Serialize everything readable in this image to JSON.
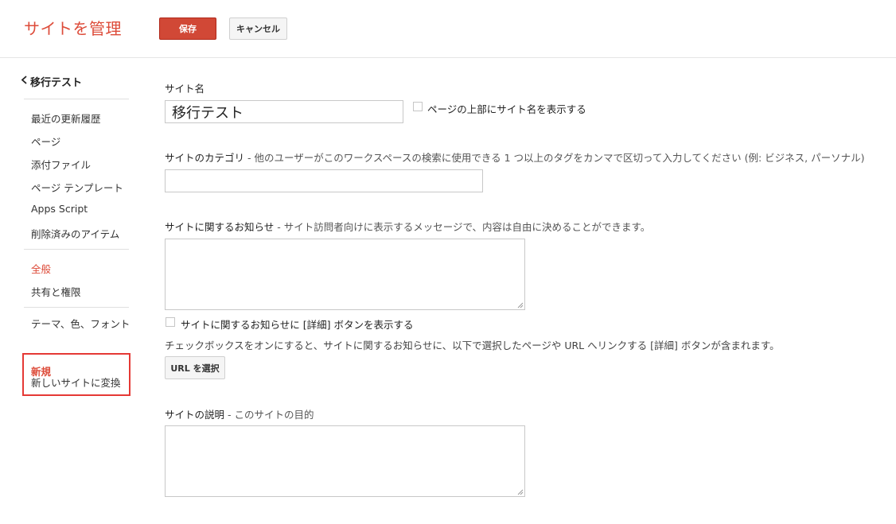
{
  "header": {
    "title": "サイトを管理",
    "save_label": "保存",
    "cancel_label": "キャンセル"
  },
  "sidebar": {
    "back_label": "移行テスト",
    "items": [
      {
        "label": "最近の更新履歴"
      },
      {
        "label": "ページ"
      },
      {
        "label": "添付ファイル"
      },
      {
        "label": "ページ テンプレート"
      },
      {
        "label": "Apps Script"
      },
      {
        "label": "削除済みのアイテム"
      }
    ],
    "general_label": "全般",
    "sharing_label": "共有と権限",
    "theme_label": "テーマ、色、フォント",
    "new_title": "新規",
    "new_subtitle": "新しいサイトに変換"
  },
  "main": {
    "site_name": {
      "label": "サイト名",
      "value": "移行テスト",
      "show_on_top_label": "ページの上部にサイト名を表示する"
    },
    "category": {
      "label": "サイトのカテゴリ",
      "description": " - 他のユーザーがこのワークスペースの検索に使用できる 1 つ以上のタグをカンマで区切って入力してください (例: ビジネス, パーソナル)"
    },
    "notice": {
      "label": "サイトに関するお知らせ",
      "description": " - サイト訪問者向けに表示するメッセージで、内容は自由に決めることができます。",
      "detail_checkbox_label": "サイトに関するお知らせに [詳細] ボタンを表示する",
      "note": "チェックボックスをオンにすると、サイトに関するお知らせに、以下で選択したページや URL へリンクする [詳細] ボタンが含まれます。",
      "url_button_label": "URL を選択"
    },
    "description": {
      "label": "サイトの説明",
      "description": " - このサイトの目的"
    }
  },
  "colors": {
    "accent": "#dd4b39",
    "highlight_border": "#e53935"
  }
}
